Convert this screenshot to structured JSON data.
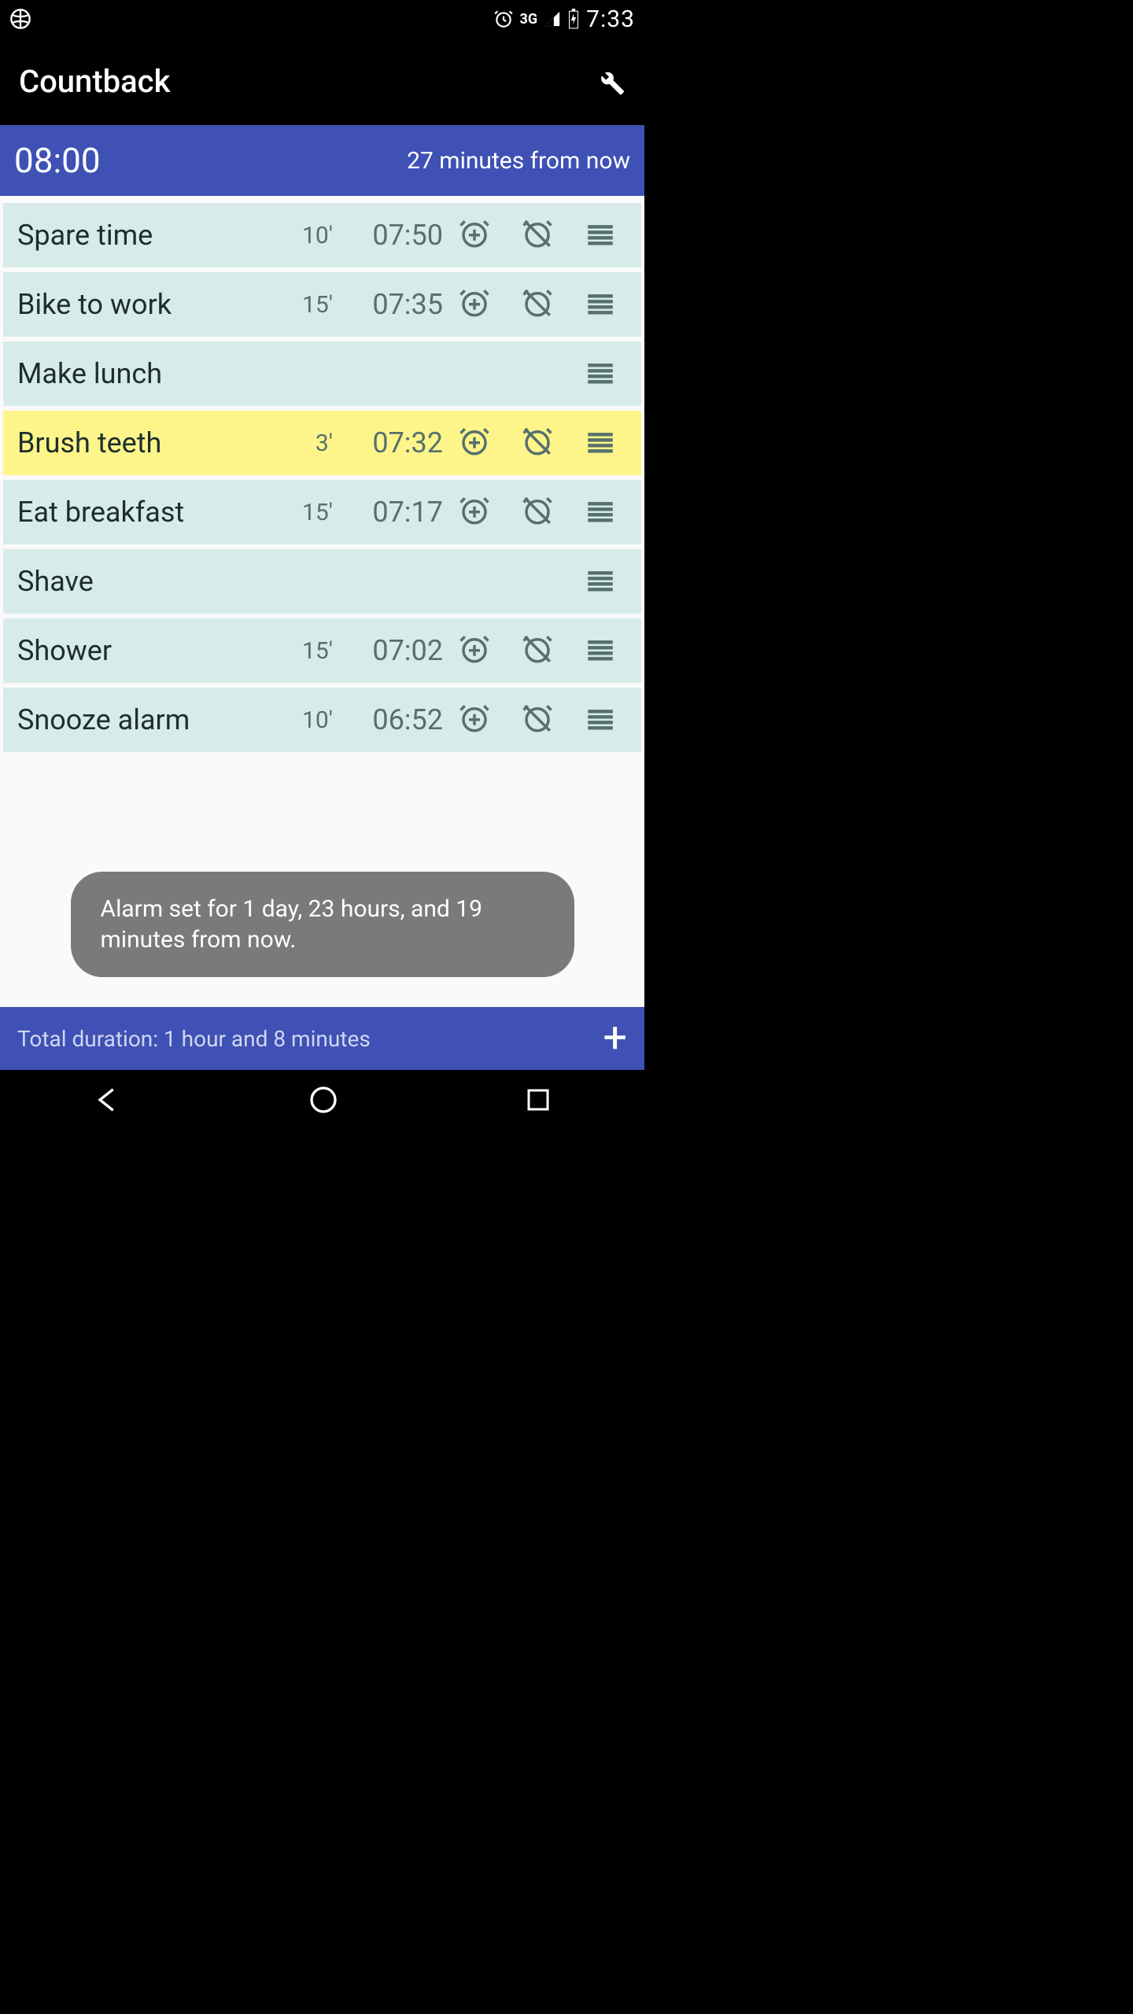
{
  "status": {
    "network": "3G",
    "time": "7:33"
  },
  "action_bar": {
    "title": "Countback"
  },
  "target": {
    "time": "08:00",
    "from_now": "27 minutes from now"
  },
  "tasks": [
    {
      "label": "Spare time",
      "duration": "10'",
      "time": "07:50",
      "icons": true,
      "highlight": false
    },
    {
      "label": "Bike to work",
      "duration": "15'",
      "time": "07:35",
      "icons": true,
      "highlight": false
    },
    {
      "label": "Make lunch",
      "duration": "",
      "time": "",
      "icons": false,
      "highlight": false
    },
    {
      "label": "Brush teeth",
      "duration": "3'",
      "time": "07:32",
      "icons": true,
      "highlight": true
    },
    {
      "label": "Eat breakfast",
      "duration": "15'",
      "time": "07:17",
      "icons": true,
      "highlight": false
    },
    {
      "label": "Shave",
      "duration": "",
      "time": "",
      "icons": false,
      "highlight": false
    },
    {
      "label": "Shower",
      "duration": "15'",
      "time": "07:02",
      "icons": true,
      "highlight": false
    },
    {
      "label": "Snooze alarm",
      "duration": "10'",
      "time": "06:52",
      "icons": true,
      "highlight": false
    }
  ],
  "toast": {
    "text": "Alarm set for 1 day, 23 hours, and 19 minutes from now."
  },
  "footer": {
    "total": "Total duration: 1 hour and 8 minutes"
  },
  "colors": {
    "primary": "#3f51b5",
    "row_bg": "#d7ecea",
    "row_highlight": "#fdf58a"
  }
}
